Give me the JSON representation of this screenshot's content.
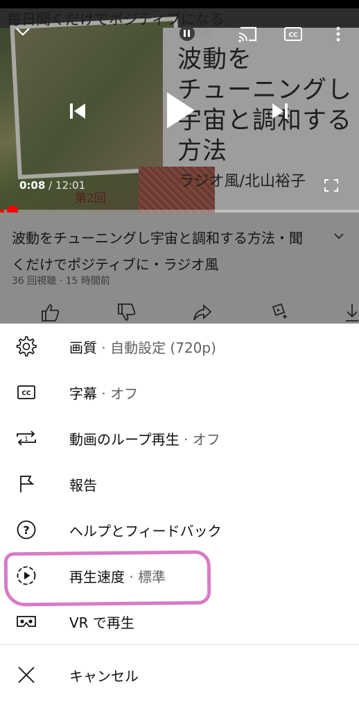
{
  "player": {
    "overlay_title": "毎日聞くだけでポジティブになる",
    "thumbnail_title": "波動を\nチューニングし\n宇宙と調和する\n方法",
    "thumbnail_credit": "ラジオ風/北山裕子",
    "thumbnail_episode": "第2回",
    "current_time": "0:08",
    "duration": "12:01",
    "progress_fraction": 0.011,
    "progress_color": "#ff0000",
    "icons": [
      "chevron-down-icon",
      "pause-toggle-icon",
      "cast-icon",
      "captions-icon",
      "more-vert-icon",
      "previous-icon",
      "play-icon",
      "next-icon",
      "fullscreen-icon"
    ]
  },
  "video": {
    "title": "波動をチューニングし宇宙と調和する方法・聞くだけでポジティブに・ラジオ風",
    "meta": "36 回視聴 · 15 時間前"
  },
  "menu": {
    "items": [
      {
        "label": "画質",
        "sub": " · 自動設定 (720p)",
        "icon": "gear-icon"
      },
      {
        "label": "字幕",
        "sub": " · オフ",
        "icon": "captions-icon"
      },
      {
        "label": "動画のループ再生",
        "sub": " · オフ",
        "icon": "loop-icon"
      },
      {
        "label": "報告",
        "sub": "",
        "icon": "flag-icon"
      },
      {
        "label": "ヘルプとフィードバック",
        "sub": "",
        "icon": "help-icon"
      },
      {
        "label": "再生速度",
        "sub": " · 標準",
        "icon": "playback-speed-icon"
      },
      {
        "label": "VR で再生",
        "sub": "",
        "icon": "vr-headset-icon"
      }
    ],
    "cancel": {
      "label": "キャンセル",
      "icon": "close-icon"
    }
  },
  "colors": {
    "highlight": "#d87bc6",
    "dim_overlay": "#8c8c8c"
  }
}
